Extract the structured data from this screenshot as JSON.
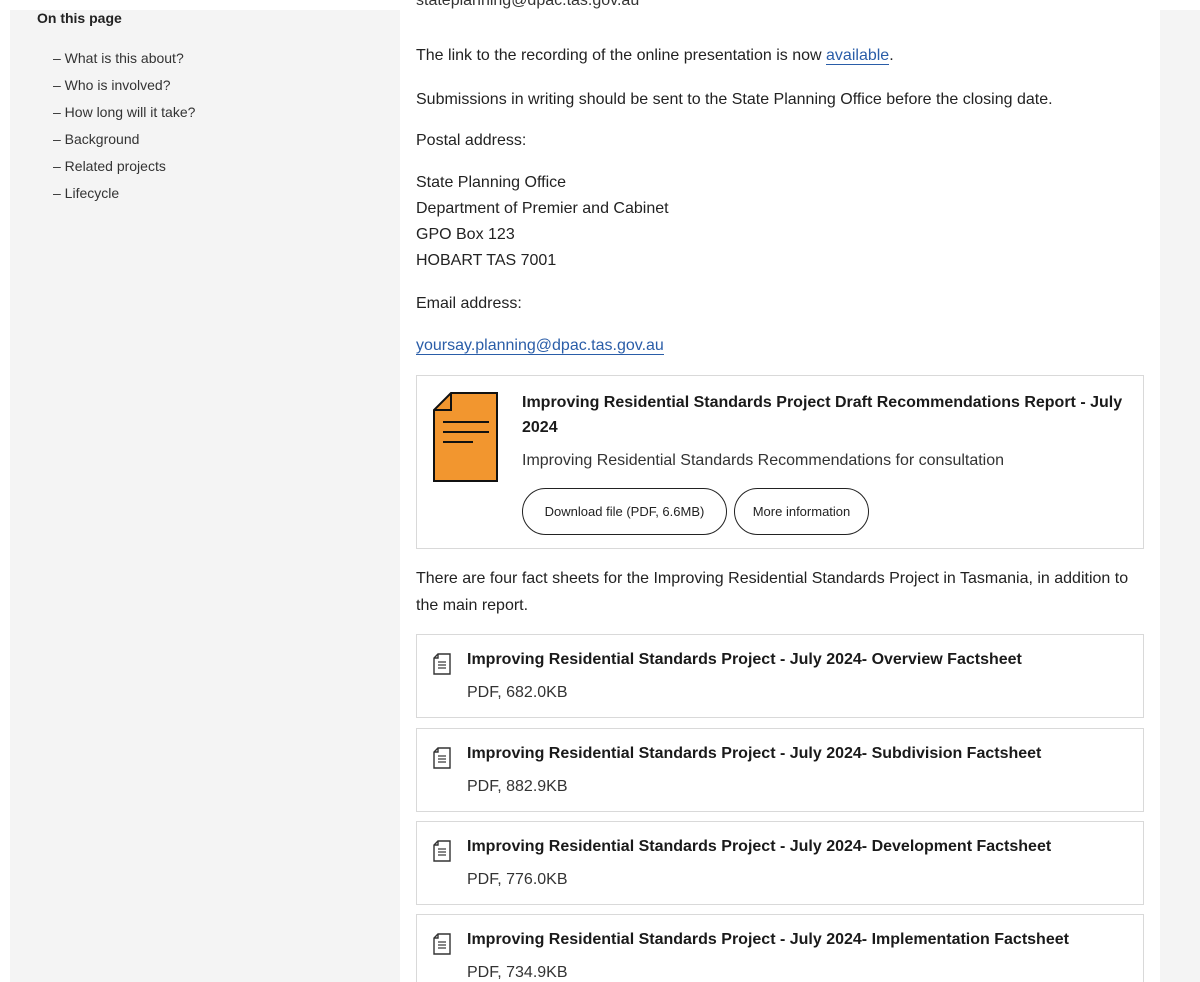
{
  "sidebar": {
    "title": "On this page",
    "items": [
      {
        "label": "– What is this about?"
      },
      {
        "label": "– Who is involved?"
      },
      {
        "label": "– How long will it take?"
      },
      {
        "label": "– Background"
      },
      {
        "label": "– Related projects"
      },
      {
        "label": "– Lifecycle"
      }
    ]
  },
  "main": {
    "cut_email": "stateplanning@dpac.tas.gov.au",
    "recording_text": "The link to the recording of the online presentation is now ",
    "recording_link": "available",
    "recording_end": ".",
    "submissions_text": "Submissions in writing should be sent to the State Planning Office before the closing date.",
    "postal_label": "Postal address:",
    "address": [
      "State Planning Office",
      "Department of Premier and Cabinet",
      "GPO Box 123",
      "HOBART TAS 7001"
    ],
    "email_label": "Email address:",
    "email": "yoursay.planning@dpac.tas.gov.au",
    "featured_doc": {
      "title": "Improving Residential Standards Project Draft Recommendations Report - July 2024",
      "description": "Improving Residential Standards Recommendations for consultation",
      "download_label": "Download file (PDF, 6.6MB)",
      "info_label": "More information",
      "thumb_color": "#f2962f"
    },
    "factsheets_intro_1": "There are four fact sheets for the Improving Residential Standards Project in Tasmania, in addition to",
    "factsheets_intro_2": "the main report.",
    "factsheets": [
      {
        "title": "Improving Residential Standards Project - July 2024- Overview Factsheet",
        "meta": "PDF, 682.0KB"
      },
      {
        "title": "Improving Residential Standards Project - July 2024- Subdivision Factsheet",
        "meta": "PDF, 882.9KB"
      },
      {
        "title": "Improving Residential Standards Project - July 2024- Development Factsheet",
        "meta": "PDF, 776.0KB"
      },
      {
        "title": "Improving Residential Standards Project - July 2024- Implementation Factsheet",
        "meta": "PDF, 734.9KB"
      }
    ]
  }
}
